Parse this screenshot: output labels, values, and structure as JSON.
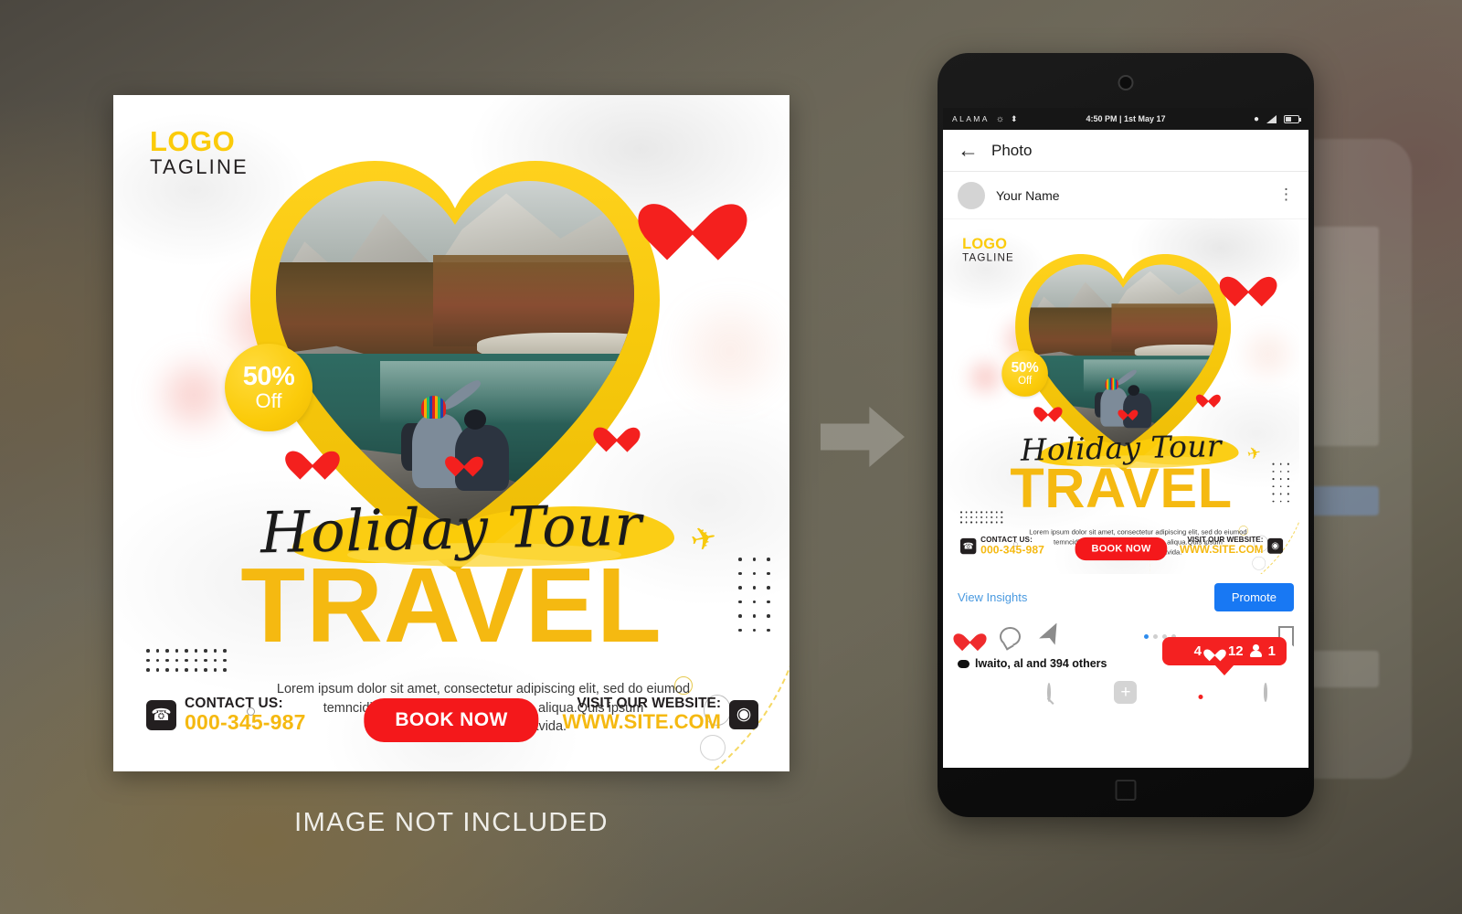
{
  "poster": {
    "logo": {
      "main": "LOGO",
      "tagline": "TAGLINE"
    },
    "badge": {
      "percent": "50%",
      "off": "Off"
    },
    "script_title": "Holiday Tour",
    "big_title": "TRAVEL",
    "body_text": "Lorem ipsum dolor sit amet, consectetur adipiscing elit, sed do eiumod temncididuntlabore et dolore magna aliqua.Quis ipsum suspendisseultrices gravida.",
    "contact": {
      "label": "CONTACT US:",
      "number": "000-345-987",
      "icon": "phone-icon"
    },
    "cta": {
      "label": "BOOK NOW"
    },
    "website": {
      "label": "VISIT OUR WEBSITE:",
      "url": "WWW.SITE.COM",
      "icon": "globe-icon"
    },
    "colors": {
      "yellow": "#F5B911",
      "red": "#F4181B",
      "dark": "#231f20"
    }
  },
  "caption": "IMAGE NOT INCLUDED",
  "arrow": {
    "name": "right-arrow"
  },
  "phone": {
    "statusbar": {
      "carrier": "ALAMA",
      "time": "4:50 PM | 1st May 17",
      "icons": [
        "wifi-icon",
        "bluetooth-icon",
        "alarm-icon",
        "signal-icon",
        "battery-icon"
      ]
    },
    "appbar": {
      "back": "back-arrow-icon",
      "title": "Photo"
    },
    "post_header": {
      "username": "Your Name",
      "menu": "kebab-menu-icon"
    },
    "actions": {
      "insights": "View Insights",
      "promote": "Promote"
    },
    "icons": {
      "like": "heart-icon",
      "comment": "comment-icon",
      "share": "send-icon",
      "save": "bookmark-icon"
    },
    "carousel": {
      "dots": 4,
      "active": 0
    },
    "notification": {
      "comments": "4",
      "likes": "12",
      "followers": "1",
      "color": "#F42121"
    },
    "likes_text": "lwaito, al  and 394 others",
    "tabbar": [
      "home-icon",
      "search-icon",
      "add-icon",
      "activity-icon",
      "profile-icon"
    ]
  }
}
